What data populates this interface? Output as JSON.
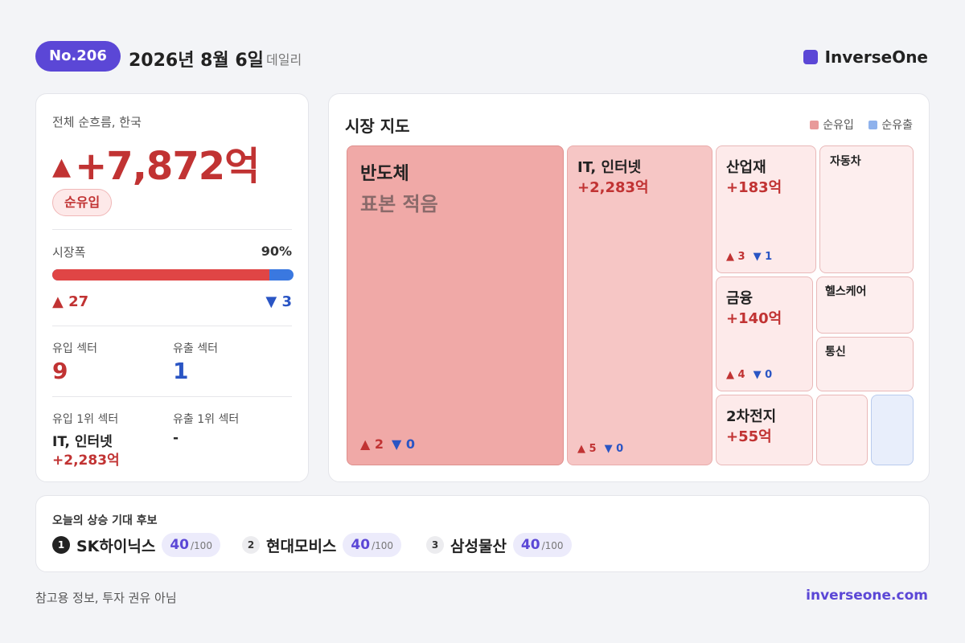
{
  "header": {
    "issue": "No.206",
    "date": "2026년 8월 6일",
    "frequency": "데일리",
    "brand": "InverseOne"
  },
  "summary": {
    "label": "전체 순흐름, 한국",
    "arrow": "▲",
    "value": "+7,872억",
    "flow_badge": "순유입",
    "breadth_label": "시장폭",
    "breadth_pct": "90%",
    "breadth_fraction": 0.9,
    "advancers": "▲ 27",
    "decliners": "▼ 3",
    "inflow_sectors_label": "유입 섹터",
    "inflow_sectors": "9",
    "outflow_sectors_label": "유출 섹터",
    "outflow_sectors": "1",
    "top_inflow_label": "유입 1위 섹터",
    "top_inflow_name": "IT, 인터넷",
    "top_inflow_value": "+2,283억",
    "top_outflow_label": "유출 1위 섹터",
    "top_outflow_name": "-"
  },
  "market_map": {
    "title": "시장 지도",
    "legend": [
      {
        "label": "순유입",
        "color": "#e89a9a"
      },
      {
        "label": "순유출",
        "color": "#8fb2ec"
      }
    ],
    "tiles": {
      "semis": {
        "name": "반도체",
        "note": "표본 적음",
        "up": "▲ 2",
        "down": "▼ 0"
      },
      "it": {
        "name": "IT, 인터넷",
        "value": "+2,283억",
        "up": "▲ 5",
        "down": "▼ 0"
      },
      "industrial": {
        "name": "산업재",
        "value": "+183억",
        "up": "▲ 3",
        "down": "▼ 1"
      },
      "auto": {
        "name": "자동차"
      },
      "finance": {
        "name": "금융",
        "value": "+140억",
        "up": "▲ 4",
        "down": "▼ 0"
      },
      "health": {
        "name": "헬스케어"
      },
      "telecom": {
        "name": "통신"
      },
      "battery": {
        "name": "2차전지",
        "value": "+55억"
      }
    }
  },
  "candidates": {
    "title": "오늘의 상승 기대 후보",
    "max_label": "/100",
    "items": [
      {
        "rank": "1",
        "name": "SK하이닉스",
        "score": "40"
      },
      {
        "rank": "2",
        "name": "현대모비스",
        "score": "40"
      },
      {
        "rank": "3",
        "name": "삼성물산",
        "score": "40"
      }
    ]
  },
  "footer": {
    "disclaimer": "참고용 정보, 투자 권유 아님",
    "site": "inverseone.com"
  }
}
